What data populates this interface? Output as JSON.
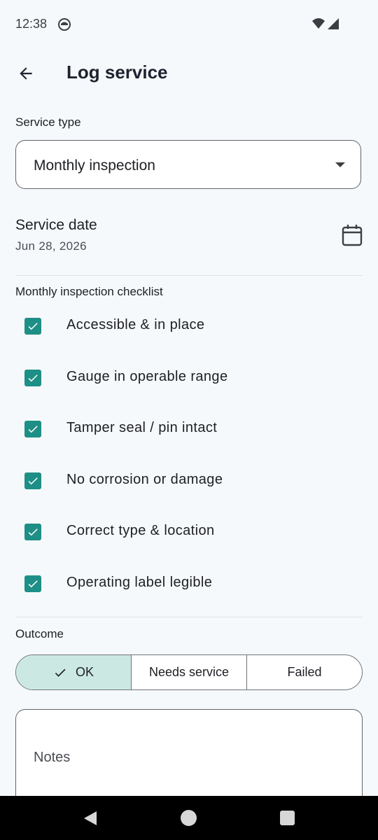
{
  "status_bar": {
    "time": "12:38"
  },
  "header": {
    "title": "Log service"
  },
  "service_type": {
    "label": "Service type",
    "value": "Monthly inspection"
  },
  "service_date": {
    "label": "Service date",
    "value": "Jun 28, 2026"
  },
  "checklist": {
    "title": "Monthly inspection checklist",
    "items": [
      {
        "label": "Accessible & in place",
        "checked": true
      },
      {
        "label": "Gauge in operable range",
        "checked": true
      },
      {
        "label": "Tamper seal / pin intact",
        "checked": true
      },
      {
        "label": "No corrosion or damage",
        "checked": true
      },
      {
        "label": "Correct type & location",
        "checked": true
      },
      {
        "label": "Operating label legible",
        "checked": true
      }
    ]
  },
  "outcome": {
    "label": "Outcome",
    "options": [
      "OK",
      "Needs service",
      "Failed"
    ],
    "selected": "OK"
  },
  "notes": {
    "placeholder": "Notes"
  },
  "colors": {
    "accent": "#1e8f86",
    "selected_segment": "#cce8e3",
    "background": "#f6f9fb"
  }
}
